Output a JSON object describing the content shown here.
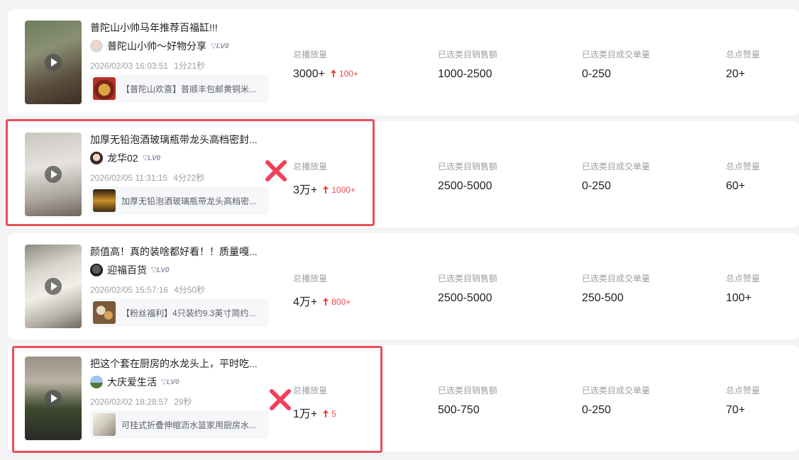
{
  "labels": {
    "plays": "总播放量",
    "sales_amount": "已选类目销售额",
    "orders": "已选类目成交单量",
    "likes": "总点赞量"
  },
  "rows": [
    {
      "title": "普陀山小帅马年推荐百福缸!!!",
      "author": "普陀山小帅～好物分享",
      "level": "LV0",
      "date": "2026/02/03 16:03:51",
      "duration": "1分21秒",
      "product": "【普陀山欢喜】普顺丰包邮黄铜米...",
      "plays": "3000+",
      "plays_delta": "100+",
      "sales_amount": "1000-2500",
      "orders": "0-250",
      "likes": "20+",
      "marked": false
    },
    {
      "title": "加厚无铅泡酒玻璃瓶带龙头高档密封...",
      "author": "龙华02",
      "level": "LV0",
      "date": "2026/02/05 11:31:15",
      "duration": "4分22秒",
      "product": "加厚无铅泡酒玻璃瓶带龙头高档密...",
      "plays": "3万+",
      "plays_delta": "1000+",
      "sales_amount": "2500-5000",
      "orders": "0-250",
      "likes": "60+",
      "marked": true
    },
    {
      "title": "颜值高！真的装啥都好看！！质量嘎...",
      "author": "迎福百货",
      "level": "LV0",
      "date": "2026/02/05 15:57:16",
      "duration": "4分50秒",
      "product": "【粉丝福利】4只装约9.3英寸简约...",
      "plays": "4万+",
      "plays_delta": "800+",
      "sales_amount": "2500-5000",
      "orders": "250-500",
      "likes": "100+",
      "marked": false
    },
    {
      "title": "把这个套在厨房的水龙头上，平时吃...",
      "author": "大庆爱生活",
      "level": "LV0",
      "date": "2026/02/02 18:28:57",
      "duration": "29秒",
      "product": "可挂式折叠伸缩沥水篮家用厨房水...",
      "plays": "1万+",
      "plays_delta": "5",
      "sales_amount": "500-750",
      "orders": "0-250",
      "likes": "70+",
      "marked": true
    }
  ],
  "colors": {
    "highlight": "#e8505b",
    "delta_up": "#f04848",
    "x_mark": "#f0405a"
  }
}
